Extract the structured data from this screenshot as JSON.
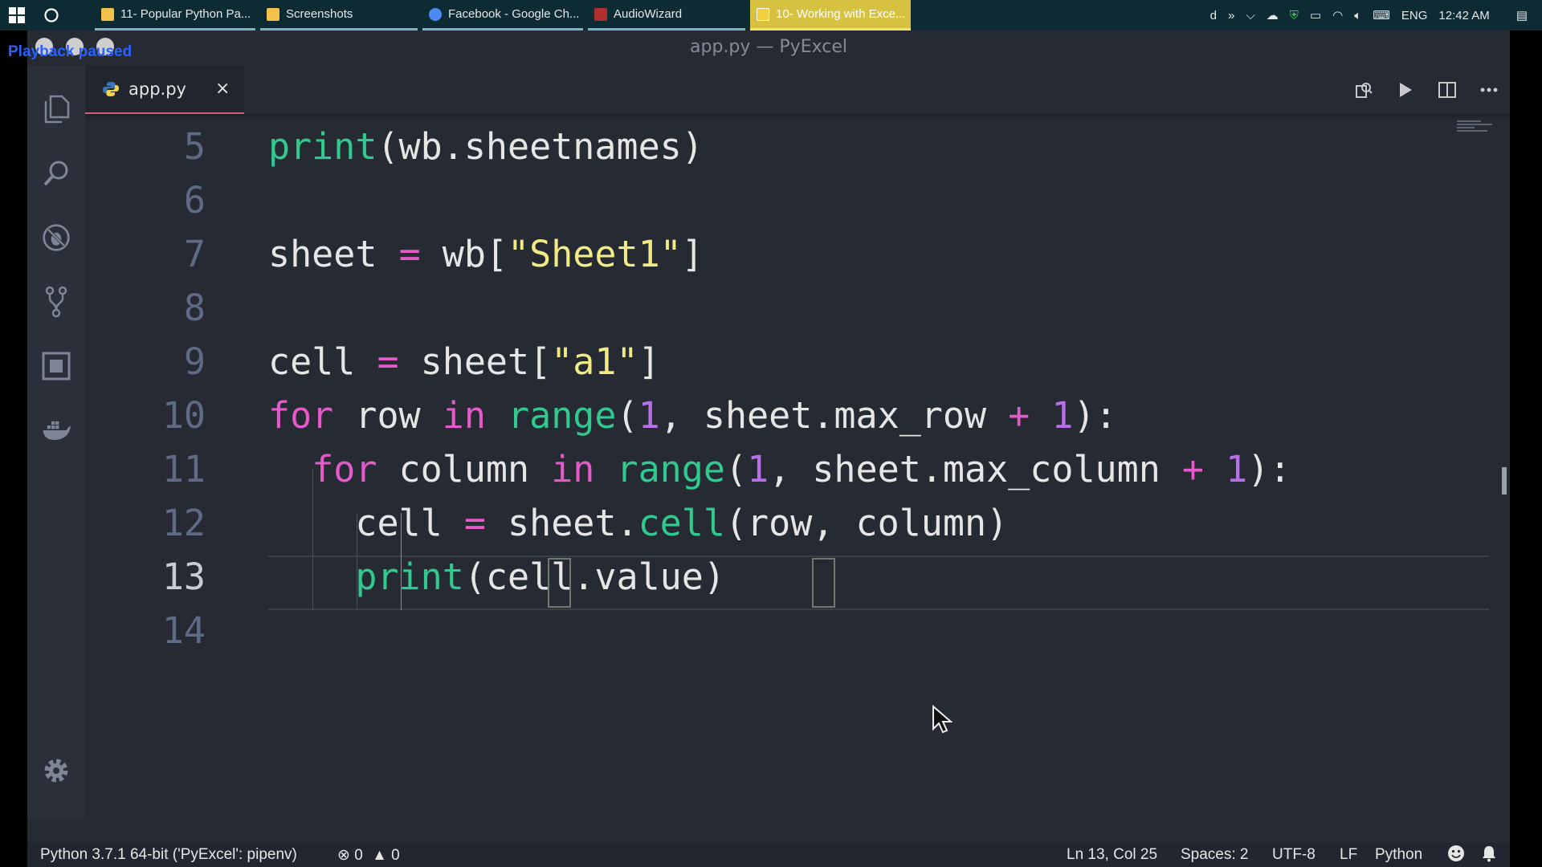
{
  "taskbar": {
    "tasks": [
      {
        "label": "11- Popular Python Pa...",
        "icon": "folder-icon",
        "color": "#f3c24c"
      },
      {
        "label": "Screenshots",
        "icon": "folder-icon",
        "color": "#f3c24c"
      },
      {
        "label": "Facebook - Google Ch...",
        "icon": "chrome-icon",
        "color": "#4c8bf5"
      },
      {
        "label": "AudioWizard",
        "icon": "audiowizard-icon",
        "color": "#b03030"
      },
      {
        "label": "10- Working with Exce...",
        "icon": "media-player-icon",
        "color": "#f4d03f"
      }
    ],
    "tray": {
      "user_initial": "d",
      "language": "ENG",
      "time": "12:42 AM"
    }
  },
  "window": {
    "title": "app.py — PyExcel",
    "playback_overlay": "Playback paused"
  },
  "tabs": [
    {
      "label": "app.py",
      "close": "×"
    }
  ],
  "editor": {
    "lines": [
      {
        "number": "5",
        "text": "print(wb.sheetnames)"
      },
      {
        "number": "6",
        "text": ""
      },
      {
        "number": "7",
        "text": "sheet = wb[\"Sheet1\"]"
      },
      {
        "number": "8",
        "text": ""
      },
      {
        "number": "9",
        "text": "cell = sheet[\"a1\"]"
      },
      {
        "number": "10",
        "text": "for row in range(1, sheet.max_row + 1):"
      },
      {
        "number": "11",
        "text": "    for column in range(1, sheet.max_column + 1):"
      },
      {
        "number": "12",
        "text": "        cell = sheet.cell(row, column)"
      },
      {
        "number": "13",
        "text": "        print(cell.value)"
      },
      {
        "number": "14",
        "text": ""
      }
    ],
    "current_line": "13"
  },
  "statusbar": {
    "interpreter": "Python 3.7.1 64-bit ('PyExcel': pipenv)",
    "errors": "0",
    "warnings": "0",
    "position": "Ln 13, Col 25",
    "spaces": "Spaces: 2",
    "encoding": "UTF-8",
    "eol": "LF",
    "language": "Python"
  },
  "colors": {
    "keyword": "#e35ac8",
    "function": "#31c98f",
    "string": "#f2ea86",
    "number": "#b86fe8",
    "accent_tab": "#c95f7d"
  }
}
